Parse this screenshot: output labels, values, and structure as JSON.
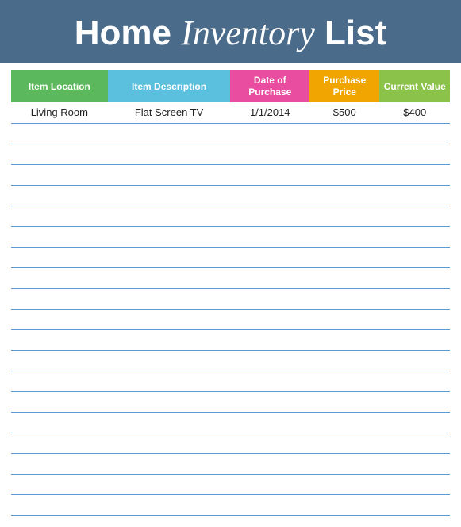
{
  "header": {
    "title_part1": "Home",
    "title_part2": "Inventory",
    "title_part3": "List"
  },
  "columns": {
    "location": "Item Location",
    "description": "Item Description",
    "date": "Date of Purchase",
    "purchase_price": "Purchase Price",
    "current_value": "Current Value"
  },
  "rows": [
    {
      "location": "Living Room",
      "description": "Flat Screen TV",
      "date": "1/1/2014",
      "purchase": "$500",
      "current": "$400"
    },
    {
      "location": "",
      "description": "",
      "date": "",
      "purchase": "",
      "current": ""
    },
    {
      "location": "",
      "description": "",
      "date": "",
      "purchase": "",
      "current": ""
    },
    {
      "location": "",
      "description": "",
      "date": "",
      "purchase": "",
      "current": ""
    },
    {
      "location": "",
      "description": "",
      "date": "",
      "purchase": "",
      "current": ""
    },
    {
      "location": "",
      "description": "",
      "date": "",
      "purchase": "",
      "current": ""
    },
    {
      "location": "",
      "description": "",
      "date": "",
      "purchase": "",
      "current": ""
    },
    {
      "location": "",
      "description": "",
      "date": "",
      "purchase": "",
      "current": ""
    },
    {
      "location": "",
      "description": "",
      "date": "",
      "purchase": "",
      "current": ""
    },
    {
      "location": "",
      "description": "",
      "date": "",
      "purchase": "",
      "current": ""
    },
    {
      "location": "",
      "description": "",
      "date": "",
      "purchase": "",
      "current": ""
    },
    {
      "location": "",
      "description": "",
      "date": "",
      "purchase": "",
      "current": ""
    },
    {
      "location": "",
      "description": "",
      "date": "",
      "purchase": "",
      "current": ""
    },
    {
      "location": "",
      "description": "",
      "date": "",
      "purchase": "",
      "current": ""
    },
    {
      "location": "",
      "description": "",
      "date": "",
      "purchase": "",
      "current": ""
    },
    {
      "location": "",
      "description": "",
      "date": "",
      "purchase": "",
      "current": ""
    },
    {
      "location": "",
      "description": "",
      "date": "",
      "purchase": "",
      "current": ""
    },
    {
      "location": "",
      "description": "",
      "date": "",
      "purchase": "",
      "current": ""
    },
    {
      "location": "",
      "description": "",
      "date": "",
      "purchase": "",
      "current": ""
    },
    {
      "location": "",
      "description": "",
      "date": "",
      "purchase": "",
      "current": ""
    }
  ]
}
